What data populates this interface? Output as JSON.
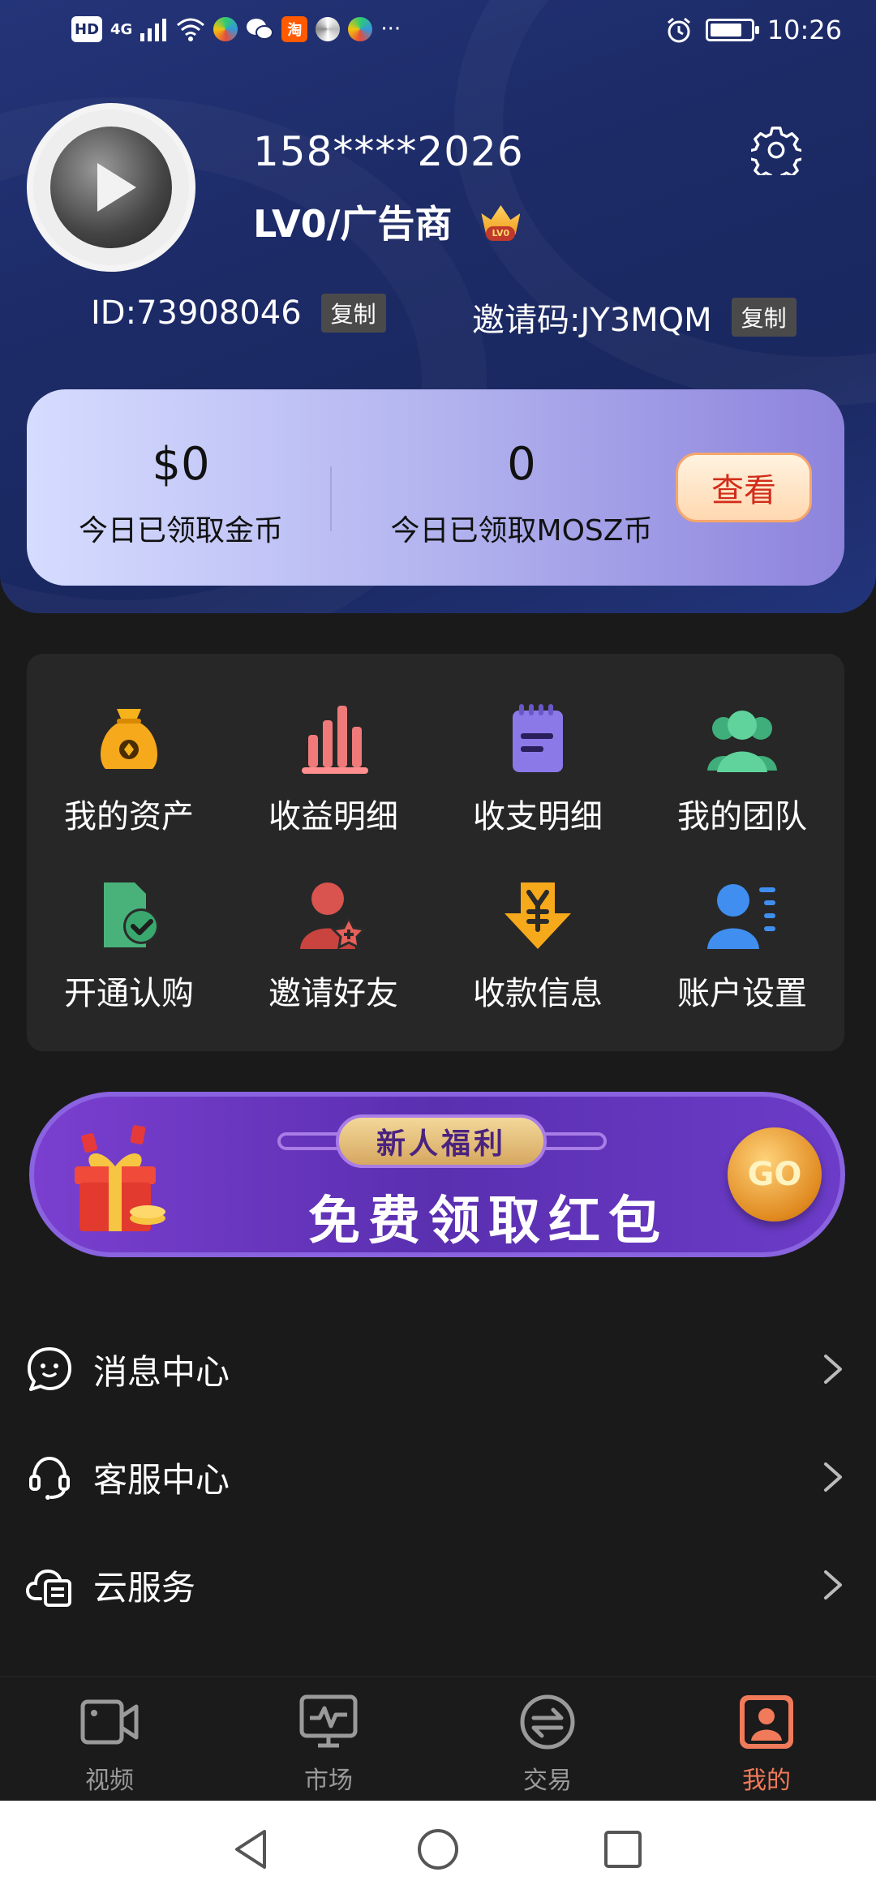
{
  "status_bar": {
    "left_badges": [
      "HD",
      "4G",
      "淘"
    ],
    "time": "10:26",
    "more": "···"
  },
  "profile": {
    "phone": "158****2026",
    "level": "LV0/广告商",
    "badge_text": "LV0",
    "id": "ID:73908046",
    "invite_code": "邀请码:JY3MQM",
    "copy_label": "复制"
  },
  "stats": {
    "coins_value": "$0",
    "coins_label": "今日已领取金币",
    "mosz_value": "0",
    "mosz_label": "今日已领取MOSZ币",
    "view_label": "查看"
  },
  "grid": [
    {
      "label": "我的资产",
      "icon": "money-bag-icon"
    },
    {
      "label": "收益明细",
      "icon": "bar-chart-icon"
    },
    {
      "label": "收支明细",
      "icon": "notepad-icon"
    },
    {
      "label": "我的团队",
      "icon": "team-icon"
    },
    {
      "label": "开通认购",
      "icon": "document-check-icon"
    },
    {
      "label": "邀请好友",
      "icon": "user-star-icon"
    },
    {
      "label": "收款信息",
      "icon": "yuan-arrow-icon"
    },
    {
      "label": "账户设置",
      "icon": "user-list-icon"
    }
  ],
  "banner": {
    "pill": "新人福利",
    "title": "免费领取红包",
    "go": "GO"
  },
  "list": [
    {
      "label": "消息中心",
      "icon": "message-icon"
    },
    {
      "label": "客服中心",
      "icon": "headset-icon"
    },
    {
      "label": "云服务",
      "icon": "cloud-service-icon"
    }
  ],
  "bottom_nav": [
    {
      "label": "视频",
      "icon": "video-icon",
      "active": false
    },
    {
      "label": "市场",
      "icon": "market-icon",
      "active": false
    },
    {
      "label": "交易",
      "icon": "exchange-icon",
      "active": false
    },
    {
      "label": "我的",
      "icon": "profile-icon",
      "active": true
    }
  ],
  "colors": {
    "header_bg": "#1c2a66",
    "page_bg": "#1a1a1a",
    "card_bg": "#272727",
    "active_nav": "#f07a5a"
  }
}
